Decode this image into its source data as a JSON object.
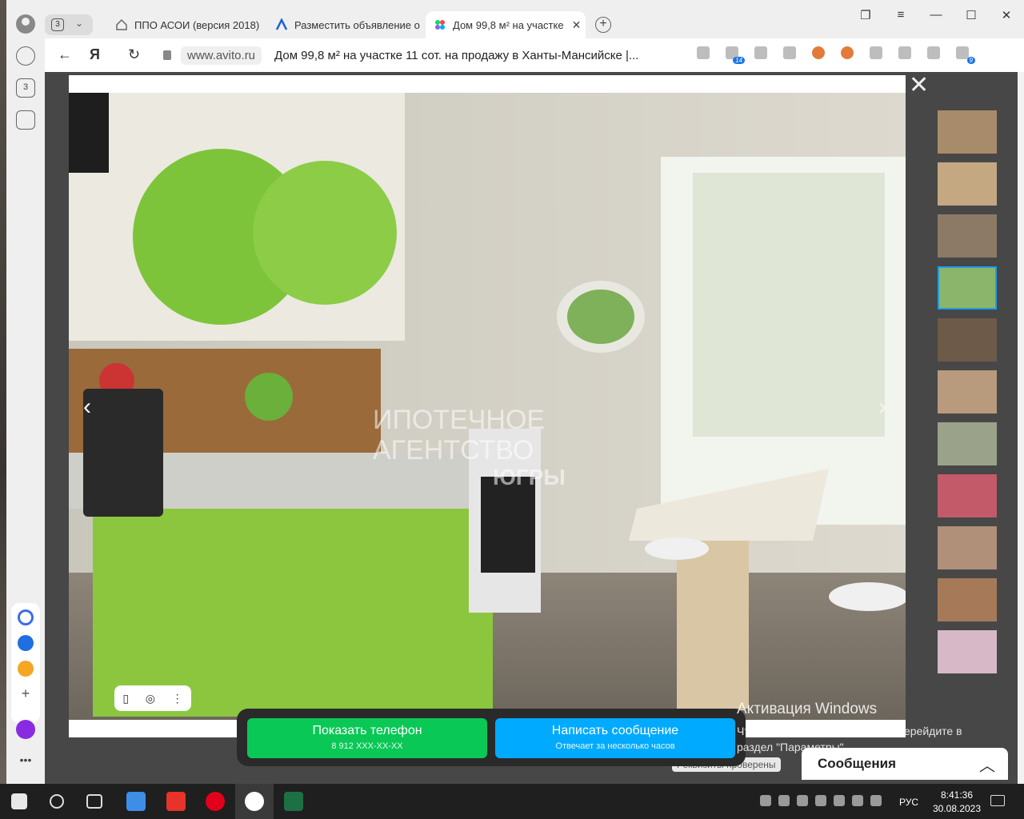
{
  "browser": {
    "tab_group_count": "3",
    "tabs": [
      {
        "title": "ППО АСОИ (версия 2018)"
      },
      {
        "title": "Разместить объявление о"
      },
      {
        "title": "Дом 99,8 м² на участке"
      }
    ],
    "domain": "www.avito.ru",
    "page_title": "Дом 99,8 м² на участке 11 сот. на продажу в Ханты-Мансийске |...",
    "download_badge": "9",
    "ext_badge": "14",
    "sidebar_tab_count": "3"
  },
  "viewer": {
    "watermark_line1": "ИПОТЕЧНОЕ",
    "watermark_line2": "АГЕНТСТВО",
    "watermark_line3": "ЮГРЫ",
    "thumbnail_count": 11,
    "selected_thumbnail": 4
  },
  "actions": {
    "phone_label": "Показать телефон",
    "phone_number": "8 912 XXX-XX-XX",
    "message_label": "Написать сообщение",
    "message_sub": "Отвечает за несколько часов"
  },
  "chat": {
    "title": "Сообщения",
    "verified_label": "Реквизиты проверены"
  },
  "windows": {
    "activation_title": "Активация Windows",
    "activation_text": "Чтобы активировать Windows, перейдите в раздел \"Параметры\"."
  },
  "taskbar": {
    "lang": "РУС",
    "time": "8:41:36",
    "date": "30.08.2023"
  },
  "colors": {
    "phone_button": "#09c856",
    "message_button": "#00aaff",
    "selected_thumb": "#1e9ce6"
  }
}
